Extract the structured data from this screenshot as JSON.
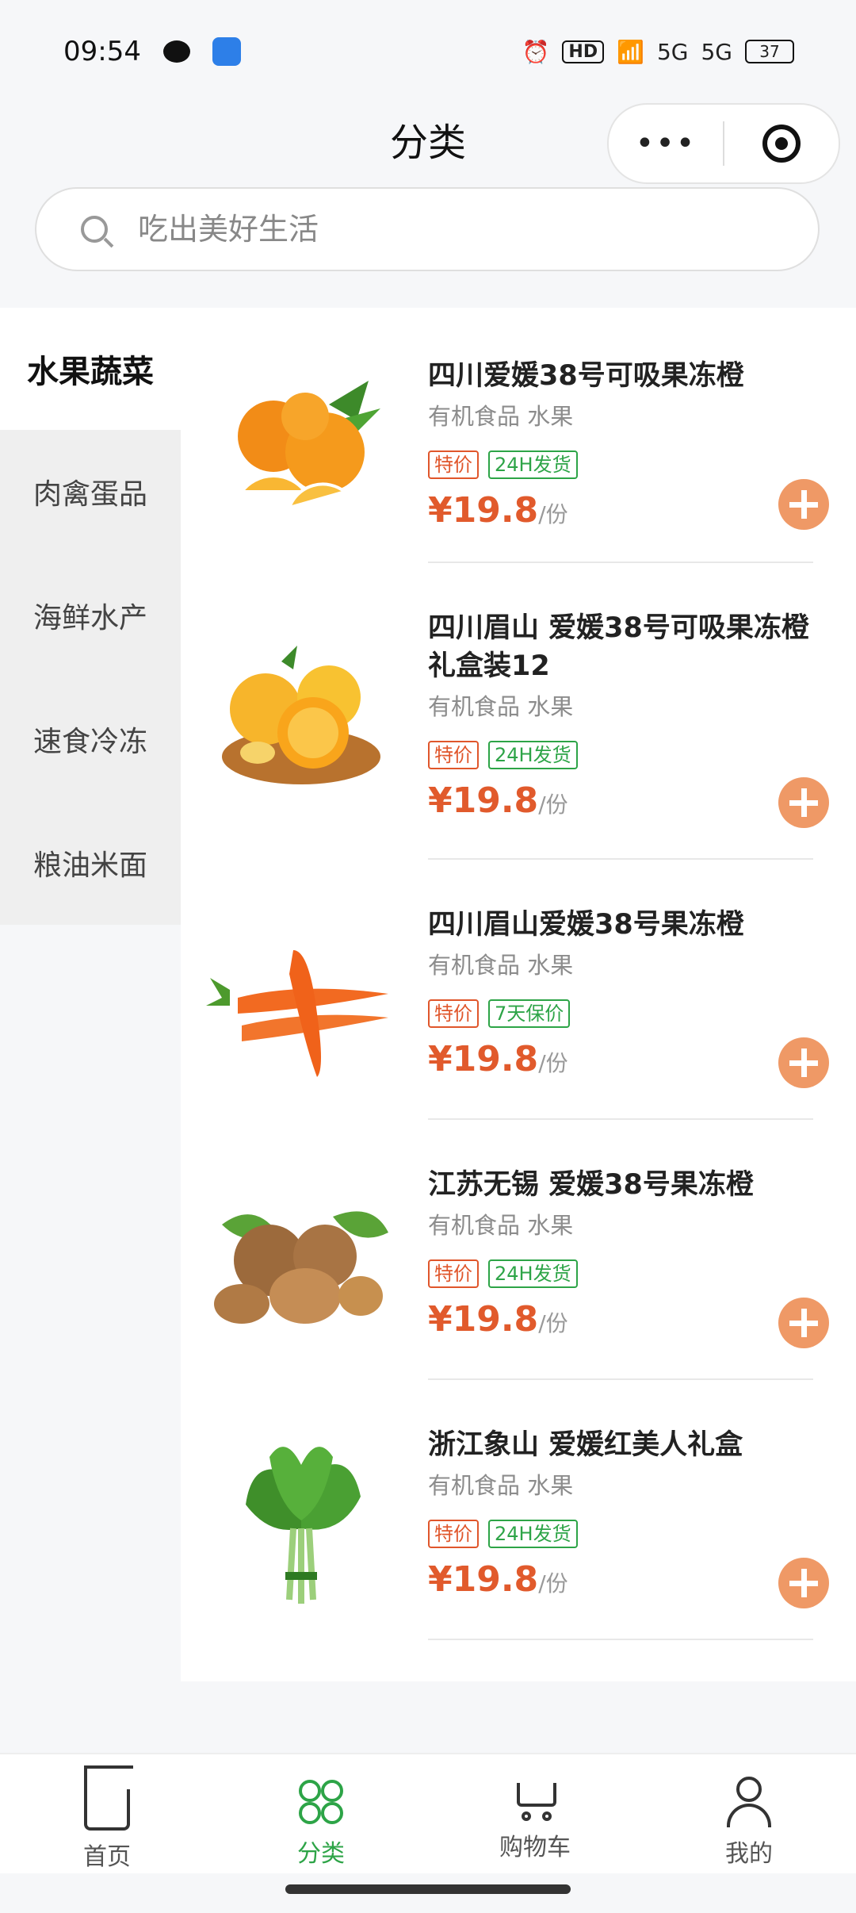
{
  "status_bar": {
    "time": "09:54",
    "battery": "37",
    "hd_label": "HD",
    "signal_label_1": "5G",
    "signal_label_2": "5G"
  },
  "header": {
    "title": "分类",
    "more_label": "•••",
    "more_icon": "more-dots-icon",
    "close_icon": "target-icon"
  },
  "search": {
    "placeholder": "吃出美好生活"
  },
  "sidebar": {
    "items": [
      {
        "label": "水果蔬菜",
        "active": true
      },
      {
        "label": "肉禽蛋品",
        "active": false
      },
      {
        "label": "海鲜水产",
        "active": false
      },
      {
        "label": "速食冷冻",
        "active": false
      },
      {
        "label": "粮油米面",
        "active": false
      }
    ]
  },
  "products": [
    {
      "name": "四川爱媛38号可吸果冻橙",
      "category": "有机食品  水果",
      "tags": [
        "特价",
        "24H发货"
      ],
      "price": "¥19.8",
      "unit": "/份",
      "image": "orange"
    },
    {
      "name": "四川眉山 爱媛38号可吸果冻橙礼盒装12",
      "category": "有机食品  水果",
      "tags": [
        "特价",
        "24H发货"
      ],
      "price": "¥19.8",
      "unit": "/份",
      "image": "orange-basket"
    },
    {
      "name": "四川眉山爱媛38号果冻橙",
      "category": "有机食品  水果",
      "tags": [
        "特价",
        "7天保价"
      ],
      "price": "¥19.8",
      "unit": "/份",
      "image": "carrot"
    },
    {
      "name": "江苏无锡 爱媛38号果冻橙",
      "category": "有机食品  水果",
      "tags": [
        "特价",
        "24H发货"
      ],
      "price": "¥19.8",
      "unit": "/份",
      "image": "walnut"
    },
    {
      "name": "浙江象山 爱媛红美人礼盒",
      "category": "有机食品  水果",
      "tags": [
        "特价",
        "24H发货"
      ],
      "price": "¥19.8",
      "unit": "/份",
      "image": "spinach"
    }
  ],
  "tabbar": {
    "items": [
      {
        "label": "首页",
        "icon": "home-icon",
        "active": false
      },
      {
        "label": "分类",
        "icon": "clover-icon",
        "active": true
      },
      {
        "label": "购物车",
        "icon": "cart-icon",
        "active": false
      },
      {
        "label": "我的",
        "icon": "user-icon",
        "active": false
      }
    ]
  },
  "colors": {
    "accent_green": "#2da447",
    "price_red": "#e15a2c",
    "add_button": "#ef9966"
  }
}
